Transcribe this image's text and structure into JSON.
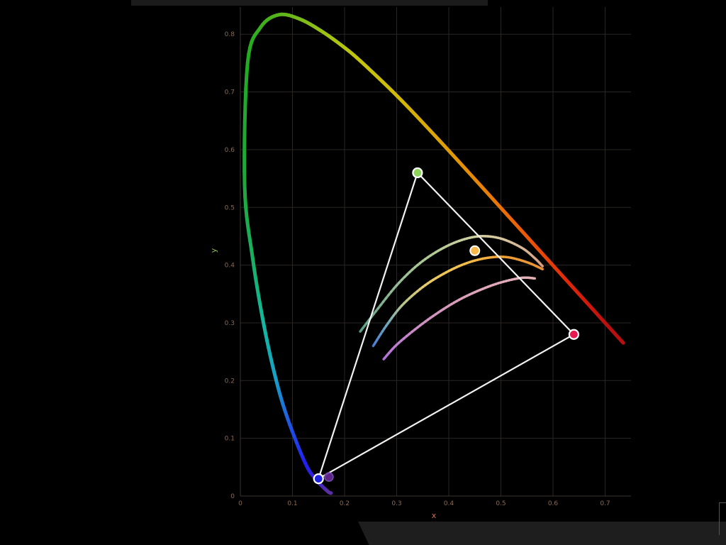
{
  "chart_data": {
    "type": "scatter",
    "title": "",
    "xlabel": "x",
    "ylabel": "y",
    "xlim": [
      0,
      0.75
    ],
    "ylim": [
      0,
      0.85
    ],
    "x_ticks": [
      "0",
      "0.1",
      "0.2",
      "0.3",
      "0.4",
      "0.5",
      "0.6",
      "0.7"
    ],
    "y_ticks": [
      "0",
      "0.1",
      "0.2",
      "0.3",
      "0.4",
      "0.5",
      "0.6",
      "0.7",
      "0.8"
    ],
    "grid": true,
    "spectral_locus": {
      "x": [
        0.1741,
        0.1666,
        0.144,
        0.1241,
        0.0913,
        0.0687,
        0.0454,
        0.0235,
        0.0082,
        0.0139,
        0.0389,
        0.0743,
        0.1142,
        0.1547,
        0.1929,
        0.2296,
        0.3016,
        0.3731,
        0.4441,
        0.5125,
        0.5752,
        0.627,
        0.6658,
        0.6915,
        0.7079,
        0.7347
      ],
      "y": [
        0.005,
        0.0089,
        0.0297,
        0.0578,
        0.1327,
        0.2007,
        0.295,
        0.4127,
        0.5384,
        0.7502,
        0.812,
        0.8338,
        0.8262,
        0.8059,
        0.7816,
        0.7543,
        0.6923,
        0.6245,
        0.5547,
        0.4866,
        0.4242,
        0.3725,
        0.334,
        0.3083,
        0.292,
        0.2653
      ],
      "colors": [
        "#5a2fa0",
        "#5a2fa0",
        "#3a20d8",
        "#2020f0",
        "#1f5fe0",
        "#16a0c8",
        "#12b8a0",
        "#18b060",
        "#1ea83a",
        "#22aa22",
        "#3aae1e",
        "#58b41a",
        "#78ba18",
        "#98c014",
        "#b0c410",
        "#c4c40c",
        "#d0b808",
        "#dca406",
        "#e68a06",
        "#ec6a06",
        "#ea4806",
        "#e02808",
        "#d0180c",
        "#c2120e",
        "#b81010",
        "#b81010"
      ]
    },
    "gamut_triangle": {
      "name": "",
      "vertices": [
        {
          "x": 0.34,
          "y": 0.56,
          "color": "#8ed45a"
        },
        {
          "x": 0.64,
          "y": 0.28,
          "color": "#e81850"
        },
        {
          "x": 0.15,
          "y": 0.03,
          "color": "#1e22e0"
        }
      ],
      "line_color": "#f2f2f2"
    },
    "points": [
      {
        "x": 0.45,
        "y": 0.425,
        "color": "#f7b84a"
      },
      {
        "x": 0.17,
        "y": 0.033,
        "color": "#6a2aa0"
      }
    ],
    "curves": [
      {
        "x": [
          0.23,
          0.26,
          0.3,
          0.34,
          0.38,
          0.42,
          0.46,
          0.5,
          0.54,
          0.565,
          0.58
        ],
        "y": [
          0.285,
          0.32,
          0.365,
          0.4,
          0.425,
          0.442,
          0.45,
          0.446,
          0.43,
          0.412,
          0.398
        ],
        "colors": [
          "#5aa08a",
          "#7ab090",
          "#98c098",
          "#a8c898",
          "#b8cc98",
          "#c8d0a0",
          "#d4d0a0",
          "#d8c8a0",
          "#d8b898",
          "#d8a888",
          "#d89a78"
        ]
      },
      {
        "x": [
          0.255,
          0.28,
          0.31,
          0.35,
          0.39,
          0.43,
          0.47,
          0.51,
          0.55,
          0.58
        ],
        "y": [
          0.26,
          0.295,
          0.33,
          0.362,
          0.385,
          0.402,
          0.412,
          0.414,
          0.405,
          0.393
        ],
        "colors": [
          "#4a7ad8",
          "#6aa8c0",
          "#b8c890",
          "#e8cc70",
          "#f2c858",
          "#f4c04a",
          "#f4b040",
          "#f0a038",
          "#ec9838",
          "#e89038"
        ]
      },
      {
        "x": [
          0.275,
          0.3,
          0.34,
          0.38,
          0.42,
          0.46,
          0.5,
          0.54,
          0.565
        ],
        "y": [
          0.237,
          0.262,
          0.292,
          0.318,
          0.34,
          0.357,
          0.37,
          0.378,
          0.377
        ],
        "colors": [
          "#b070d8",
          "#c080d0",
          "#d090c8",
          "#d898c0",
          "#dca0bc",
          "#e0a8bc",
          "#e2acbc",
          "#e4b0b8",
          "#e4b0b4"
        ]
      }
    ]
  }
}
